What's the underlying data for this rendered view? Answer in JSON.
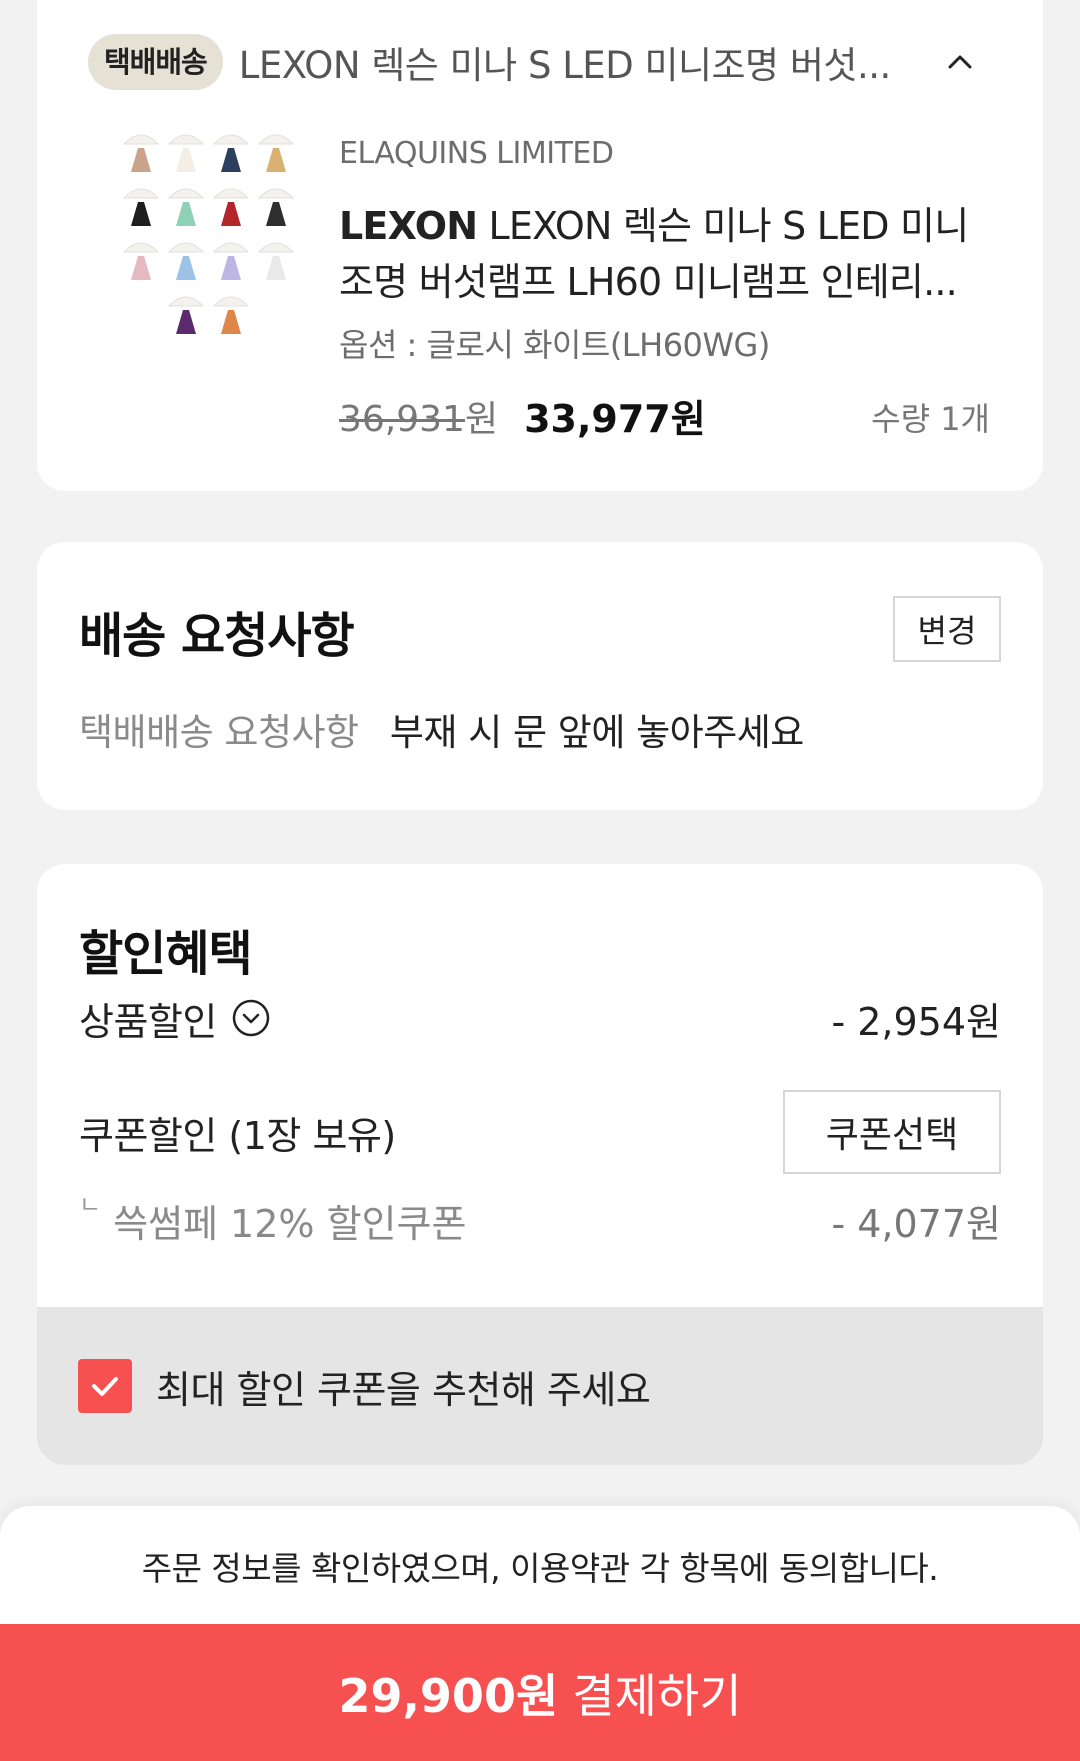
{
  "product": {
    "shipping_badge": "택배배송",
    "shipping_title": "LEXON 렉슨 미나 S LED 미니조명 버섯...",
    "seller": "ELAQUINS LIMITED",
    "brand": "LEXON",
    "name": "LEXON 렉슨 미나 S LED 미니조명 버섯램프 LH60 미니램프 인테리...",
    "option": "옵션 : 글로시 화이트(LH60WG)",
    "original_price": "36,931",
    "original_price_unit": "원",
    "sale_price": "33,977원",
    "quantity": "수량 1개",
    "lamp_colors": [
      "#c9a38a",
      "#f4efe4",
      "#2b3f5e",
      "#d8b170",
      "#1e1e1e",
      "#8fd0b8",
      "#b3262c",
      "#2e2e2e",
      "#e6b9c2",
      "#9cc3e6",
      "#bdb6e4",
      "#e9e9e9",
      "#5d2a6e",
      "#e1864a"
    ]
  },
  "delivery": {
    "title": "배송 요청사항",
    "change_label": "변경",
    "request_label": "택배배송 요청사항",
    "request_value": "부재 시 문 앞에 놓아주세요"
  },
  "discount": {
    "title": "할인혜택",
    "product_discount_label": "상품할인",
    "product_discount_value": "- 2,954원",
    "coupon_label": "쿠폰할인 (1장 보유)",
    "coupon_button": "쿠폰선택",
    "coupon_corner": "ㄴ",
    "coupon_name": "쓱썸페 12% 할인쿠폰",
    "coupon_value": "- 4,077원",
    "recommend_text": "최대 할인 쿠폰을 추천해 주세요",
    "recommend_checked": true
  },
  "footer": {
    "agreement": "주문 정보를 확인하였으며, 이용약관 각 항목에 동의합니다.",
    "pay_amount": "29,900원",
    "pay_label": "결제하기"
  },
  "colors": {
    "accent": "#f65050",
    "badge_bg": "#e6e1d5",
    "page_bg": "#f2f2f2"
  }
}
